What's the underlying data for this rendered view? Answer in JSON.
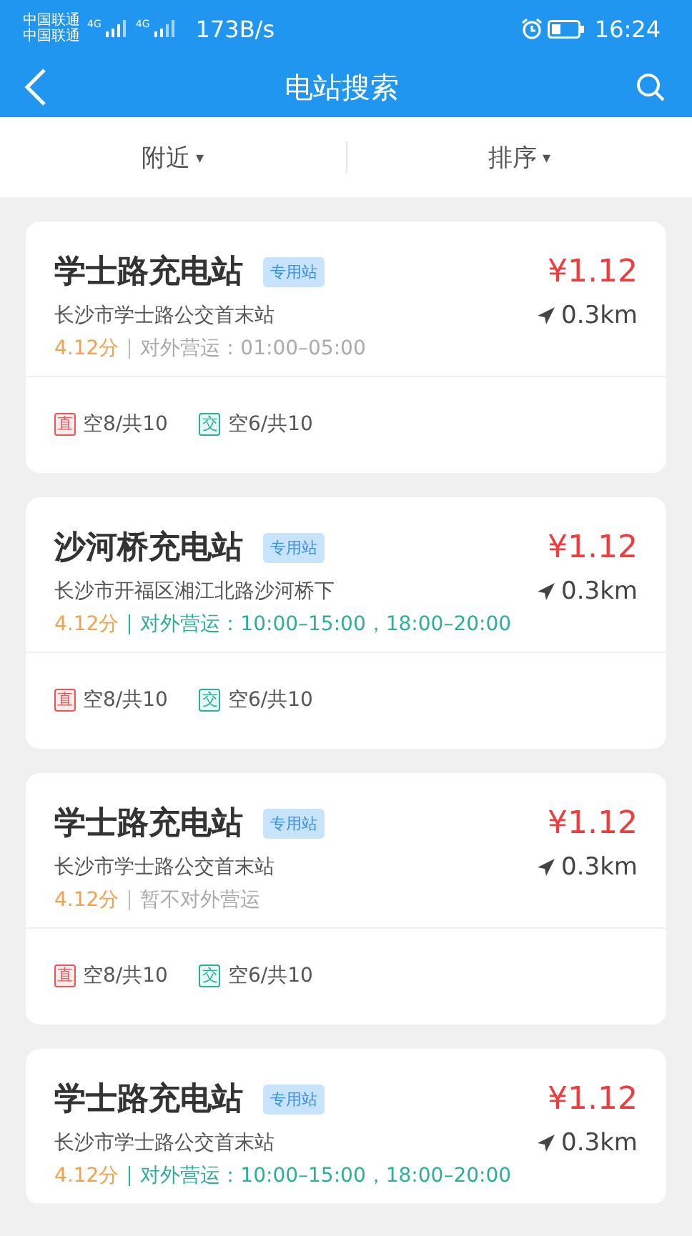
{
  "status_bar": {
    "carrier_1": "中国联通",
    "carrier_2": "中国联通",
    "network_1": "4G",
    "network_2": "4G",
    "speed": "173B/s",
    "time": "16:24"
  },
  "nav": {
    "title": "电站搜索"
  },
  "filters": [
    {
      "label": "附近",
      "caret": "▾"
    },
    {
      "label": "排序",
      "caret": "▾"
    }
  ],
  "stations": [
    {
      "name": "学士路充电站",
      "tag": "专用站",
      "price": "¥1.12",
      "address": "长沙市学士路公交首末站",
      "distance": "0.3km",
      "rating": "4.12分",
      "hours": "对外营运：01:00–05:00",
      "hours_active": false,
      "chargers": [
        {
          "kind": "dc",
          "label": "直",
          "count": "空8/共10"
        },
        {
          "kind": "ac",
          "label": "交",
          "count": "空6/共10"
        }
      ]
    },
    {
      "name": "沙河桥充电站",
      "tag": "专用站",
      "price": "¥1.12",
      "address": "长沙市开福区湘江北路沙河桥下",
      "distance": "0.3km",
      "rating": "4.12分",
      "hours": "对外营运：10:00–15:00，18:00–20:00",
      "hours_active": true,
      "chargers": [
        {
          "kind": "dc",
          "label": "直",
          "count": "空8/共10"
        },
        {
          "kind": "ac",
          "label": "交",
          "count": "空6/共10"
        }
      ]
    },
    {
      "name": "学士路充电站",
      "tag": "专用站",
      "price": "¥1.12",
      "address": "长沙市学士路公交首末站",
      "distance": "0.3km",
      "rating": "4.12分",
      "hours": "暂不对外营运",
      "hours_active": false,
      "chargers": [
        {
          "kind": "dc",
          "label": "直",
          "count": "空8/共10"
        },
        {
          "kind": "ac",
          "label": "交",
          "count": "空6/共10"
        }
      ]
    },
    {
      "name": "学士路充电站",
      "tag": "专用站",
      "price": "¥1.12",
      "address": "长沙市学士路公交首末站",
      "distance": "0.3km",
      "rating": "4.12分",
      "hours": "对外营运：10:00–15:00，18:00–20:00",
      "hours_active": true
    }
  ]
}
